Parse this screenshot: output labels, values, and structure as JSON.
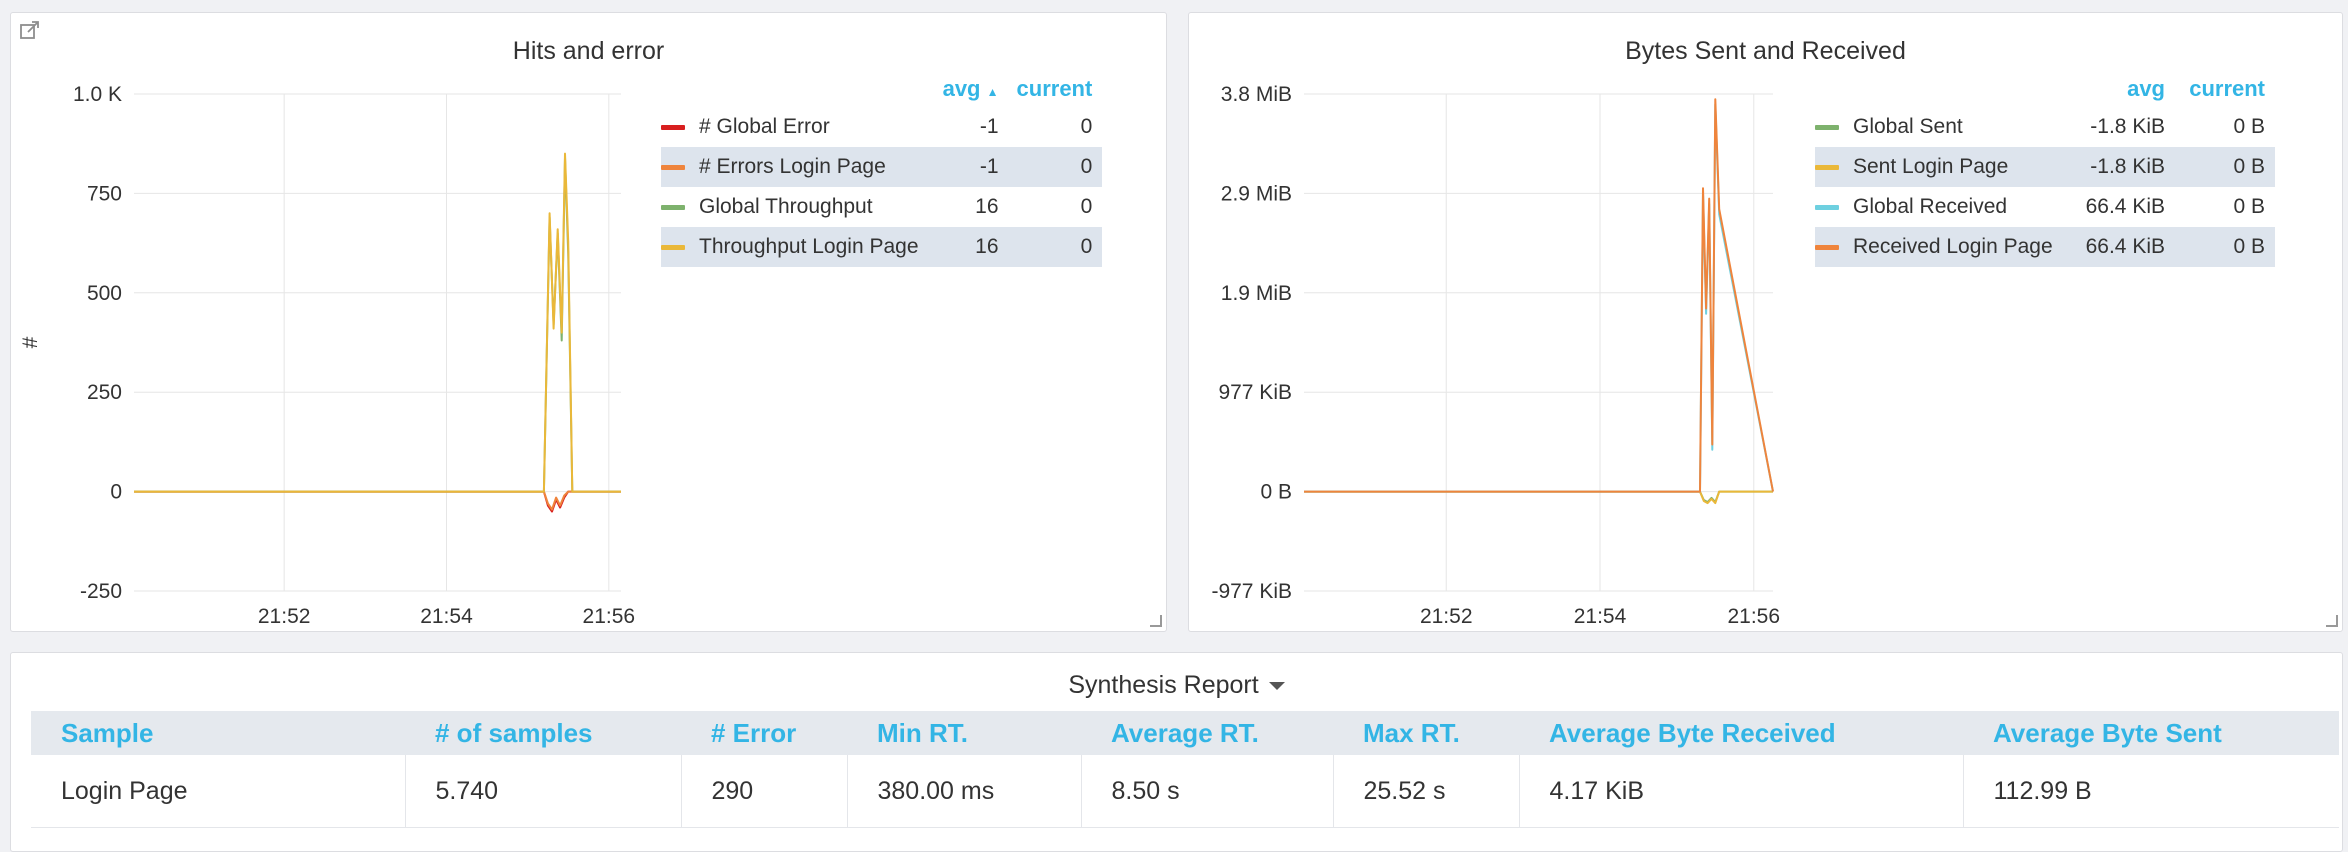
{
  "colors": {
    "accent_blue": "#33b5e5",
    "global_error": "#d81f1f",
    "errors_login": "#ef843c",
    "global_throughput": "#7eb26d",
    "throughput_login": "#eab839",
    "global_received": "#6ed0e0",
    "received_login": "#ef843c"
  },
  "panels": {
    "hits": {
      "title": "Hits and error",
      "legend": {
        "headers": {
          "avg": "avg",
          "current": "current"
        },
        "rows": [
          {
            "label": "# Global Error",
            "avg": "-1",
            "current": "0",
            "color": "#d81f1f"
          },
          {
            "label": "# Errors Login Page",
            "avg": "-1",
            "current": "0",
            "color": "#ef843c"
          },
          {
            "label": "Global Throughput",
            "avg": "16",
            "current": "0",
            "color": "#7eb26d"
          },
          {
            "label": "Throughput Login Page",
            "avg": "16",
            "current": "0",
            "color": "#eab839"
          }
        ]
      }
    },
    "bytes": {
      "title": "Bytes Sent and Received",
      "legend": {
        "headers": {
          "avg": "avg",
          "current": "current"
        },
        "rows": [
          {
            "label": "Global Sent",
            "avg": "-1.8 KiB",
            "current": "0 B",
            "color": "#7eb26d"
          },
          {
            "label": "Sent Login Page",
            "avg": "-1.8 KiB",
            "current": "0 B",
            "color": "#eab839"
          },
          {
            "label": "Global Received",
            "avg": "66.4 KiB",
            "current": "0 B",
            "color": "#6ed0e0"
          },
          {
            "label": "Received Login Page",
            "avg": "66.4 KiB",
            "current": "0 B",
            "color": "#ef843c"
          }
        ]
      }
    },
    "report": {
      "title": "Synthesis Report",
      "columns": [
        "Sample",
        "# of samples",
        "# Error",
        "Min RT.",
        "Average RT.",
        "Max RT.",
        "Average Byte Received",
        "Average Byte Sent"
      ],
      "rows": [
        [
          "Login Page",
          "5.740",
          "290",
          "380.00 ms",
          "8.50 s",
          "25.52 s",
          "4.17 KiB",
          "112.99 B"
        ]
      ]
    }
  },
  "chart_data": [
    {
      "type": "line",
      "title": "Hits and error",
      "ylabel": "#",
      "xlabel": "",
      "y_ticks": [
        "1.0 K",
        "750",
        "500",
        "250",
        "0",
        "-250"
      ],
      "y_tick_values": [
        1000,
        750,
        500,
        250,
        0,
        -250
      ],
      "x_ticks": [
        "21:52",
        "21:54",
        "21:56"
      ],
      "x_tick_values": [
        1312,
        1314,
        1316
      ],
      "x_unit": "minutes of day",
      "ylim": [
        -250,
        1000
      ],
      "xlim": [
        1310.15,
        1316.15
      ],
      "grid": true,
      "legend_position": "right",
      "series": [
        {
          "name": "# Global Error",
          "color": "#d81f1f",
          "x": [
            1310.15,
            1315.2,
            1315.25,
            1315.3,
            1315.35,
            1315.4,
            1315.45,
            1315.5,
            1315.55,
            1316.15
          ],
          "y": [
            0,
            0,
            -35,
            -50,
            -20,
            -40,
            -15,
            0,
            0,
            0
          ]
        },
        {
          "name": "# Errors Login Page",
          "color": "#ef843c",
          "x": [
            1310.15,
            1315.2,
            1315.25,
            1315.3,
            1315.35,
            1315.4,
            1315.45,
            1315.5,
            1315.55,
            1316.15
          ],
          "y": [
            0,
            0,
            -30,
            -45,
            -15,
            -35,
            -10,
            0,
            0,
            0
          ]
        },
        {
          "name": "Global Throughput",
          "color": "#7eb26d",
          "x": [
            1310.15,
            1315.2,
            1315.27,
            1315.32,
            1315.37,
            1315.42,
            1315.46,
            1315.5,
            1315.55,
            1316.15
          ],
          "y": [
            0,
            0,
            690,
            420,
            650,
            380,
            840,
            600,
            0,
            0
          ]
        },
        {
          "name": "Throughput Login Page",
          "color": "#eab839",
          "x": [
            1310.15,
            1315.2,
            1315.27,
            1315.32,
            1315.37,
            1315.42,
            1315.46,
            1315.5,
            1315.55,
            1316.15
          ],
          "y": [
            0,
            0,
            700,
            410,
            660,
            400,
            850,
            630,
            0,
            0
          ]
        }
      ]
    },
    {
      "type": "line",
      "title": "Bytes Sent and Received",
      "ylabel": "",
      "xlabel": "",
      "y_ticks": [
        "3.8 MiB",
        "2.9 MiB",
        "1.9 MiB",
        "977 KiB",
        "0 B",
        "-977 KiB"
      ],
      "y_tick_values": [
        3.8,
        2.85,
        1.9,
        0.95,
        0,
        -0.95
      ],
      "y_unit": "MiB",
      "x_ticks": [
        "21:52",
        "21:54",
        "21:56"
      ],
      "x_tick_values": [
        1312,
        1314,
        1316
      ],
      "x_unit": "minutes of day",
      "ylim": [
        -0.95,
        3.8
      ],
      "xlim": [
        1310.15,
        1316.25
      ],
      "grid": true,
      "legend_position": "right",
      "series": [
        {
          "name": "Global Sent",
          "color": "#7eb26d",
          "x": [
            1310.15,
            1315.3,
            1315.35,
            1315.4,
            1315.45,
            1315.5,
            1315.55,
            1316.25
          ],
          "y": [
            0,
            0,
            -0.08,
            -0.1,
            -0.06,
            -0.1,
            0,
            0
          ]
        },
        {
          "name": "Sent Login Page",
          "color": "#eab839",
          "x": [
            1310.15,
            1315.3,
            1315.35,
            1315.4,
            1315.45,
            1315.5,
            1315.55,
            1316.25
          ],
          "y": [
            0,
            0,
            -0.09,
            -0.11,
            -0.07,
            -0.11,
            0,
            0
          ]
        },
        {
          "name": "Global Received",
          "color": "#6ed0e0",
          "x": [
            1310.15,
            1315.3,
            1315.34,
            1315.38,
            1315.42,
            1315.46,
            1315.5,
            1315.55,
            1316.25
          ],
          "y": [
            0,
            0,
            2.85,
            1.7,
            2.75,
            0.4,
            3.7,
            2.65,
            0
          ]
        },
        {
          "name": "Received Login Page",
          "color": "#ef843c",
          "x": [
            1310.15,
            1315.3,
            1315.34,
            1315.38,
            1315.42,
            1315.46,
            1315.5,
            1315.55,
            1316.25
          ],
          "y": [
            0,
            0,
            2.9,
            1.75,
            2.8,
            0.45,
            3.75,
            2.7,
            0
          ]
        }
      ]
    }
  ]
}
